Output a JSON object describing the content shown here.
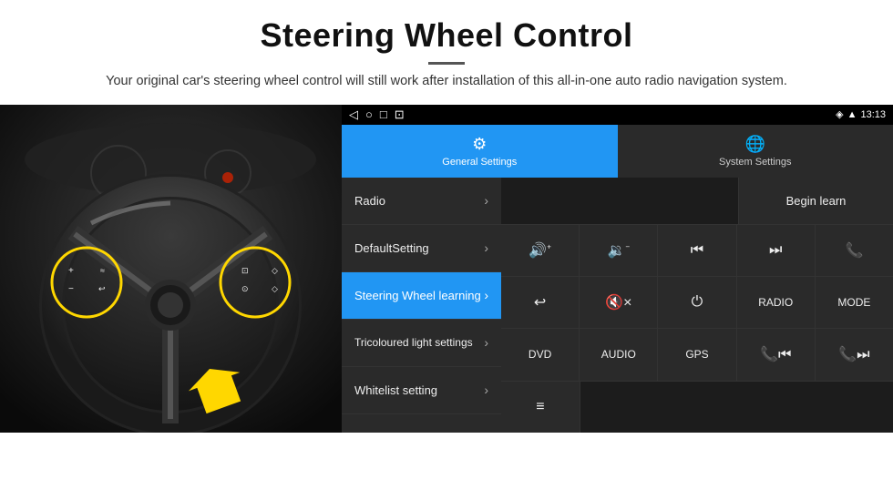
{
  "header": {
    "title": "Steering Wheel Control",
    "subtitle": "Your original car's steering wheel control will still work after installation of this all-in-one auto radio navigation system."
  },
  "status_bar": {
    "back_icon": "◁",
    "home_icon": "○",
    "recents_icon": "□",
    "screenshot_icon": "⊡",
    "signal_icon": "▾",
    "wifi_icon": "▾",
    "time": "13:13"
  },
  "tabs": [
    {
      "id": "general",
      "label": "General Settings",
      "icon": "⚙",
      "active": true
    },
    {
      "id": "system",
      "label": "System Settings",
      "icon": "🌐",
      "active": false
    }
  ],
  "menu_items": [
    {
      "id": "radio",
      "label": "Radio",
      "active": false
    },
    {
      "id": "default",
      "label": "DefaultSetting",
      "active": false
    },
    {
      "id": "steering",
      "label": "Steering Wheel learning",
      "active": true
    },
    {
      "id": "tricoloured",
      "label": "Tricoloured light settings",
      "active": false
    },
    {
      "id": "whitelist",
      "label": "Whitelist setting",
      "active": false
    }
  ],
  "begin_learn_label": "Begin learn",
  "control_buttons": {
    "row1": [
      {
        "id": "vol-up",
        "label": "🔊+",
        "type": "icon"
      },
      {
        "id": "vol-down",
        "label": "🔉−",
        "type": "icon"
      },
      {
        "id": "prev",
        "label": "⏮",
        "type": "icon"
      },
      {
        "id": "next",
        "label": "⏭",
        "type": "icon"
      },
      {
        "id": "phone",
        "label": "📞",
        "type": "icon"
      }
    ],
    "row2": [
      {
        "id": "hang-up",
        "label": "↩",
        "type": "icon"
      },
      {
        "id": "mute",
        "label": "🔇×",
        "type": "icon"
      },
      {
        "id": "power",
        "label": "⏻",
        "type": "icon"
      },
      {
        "id": "radio-btn",
        "label": "RADIO",
        "type": "text"
      },
      {
        "id": "mode",
        "label": "MODE",
        "type": "text"
      }
    ],
    "row3": [
      {
        "id": "dvd",
        "label": "DVD",
        "type": "text"
      },
      {
        "id": "audio",
        "label": "AUDIO",
        "type": "text"
      },
      {
        "id": "gps",
        "label": "GPS",
        "type": "text"
      },
      {
        "id": "prev-phone",
        "label": "📞⏮",
        "type": "icon"
      },
      {
        "id": "next-phone",
        "label": "📞⏭",
        "type": "icon"
      }
    ],
    "row4": [
      {
        "id": "equalizer",
        "label": "≡",
        "type": "icon"
      }
    ]
  }
}
